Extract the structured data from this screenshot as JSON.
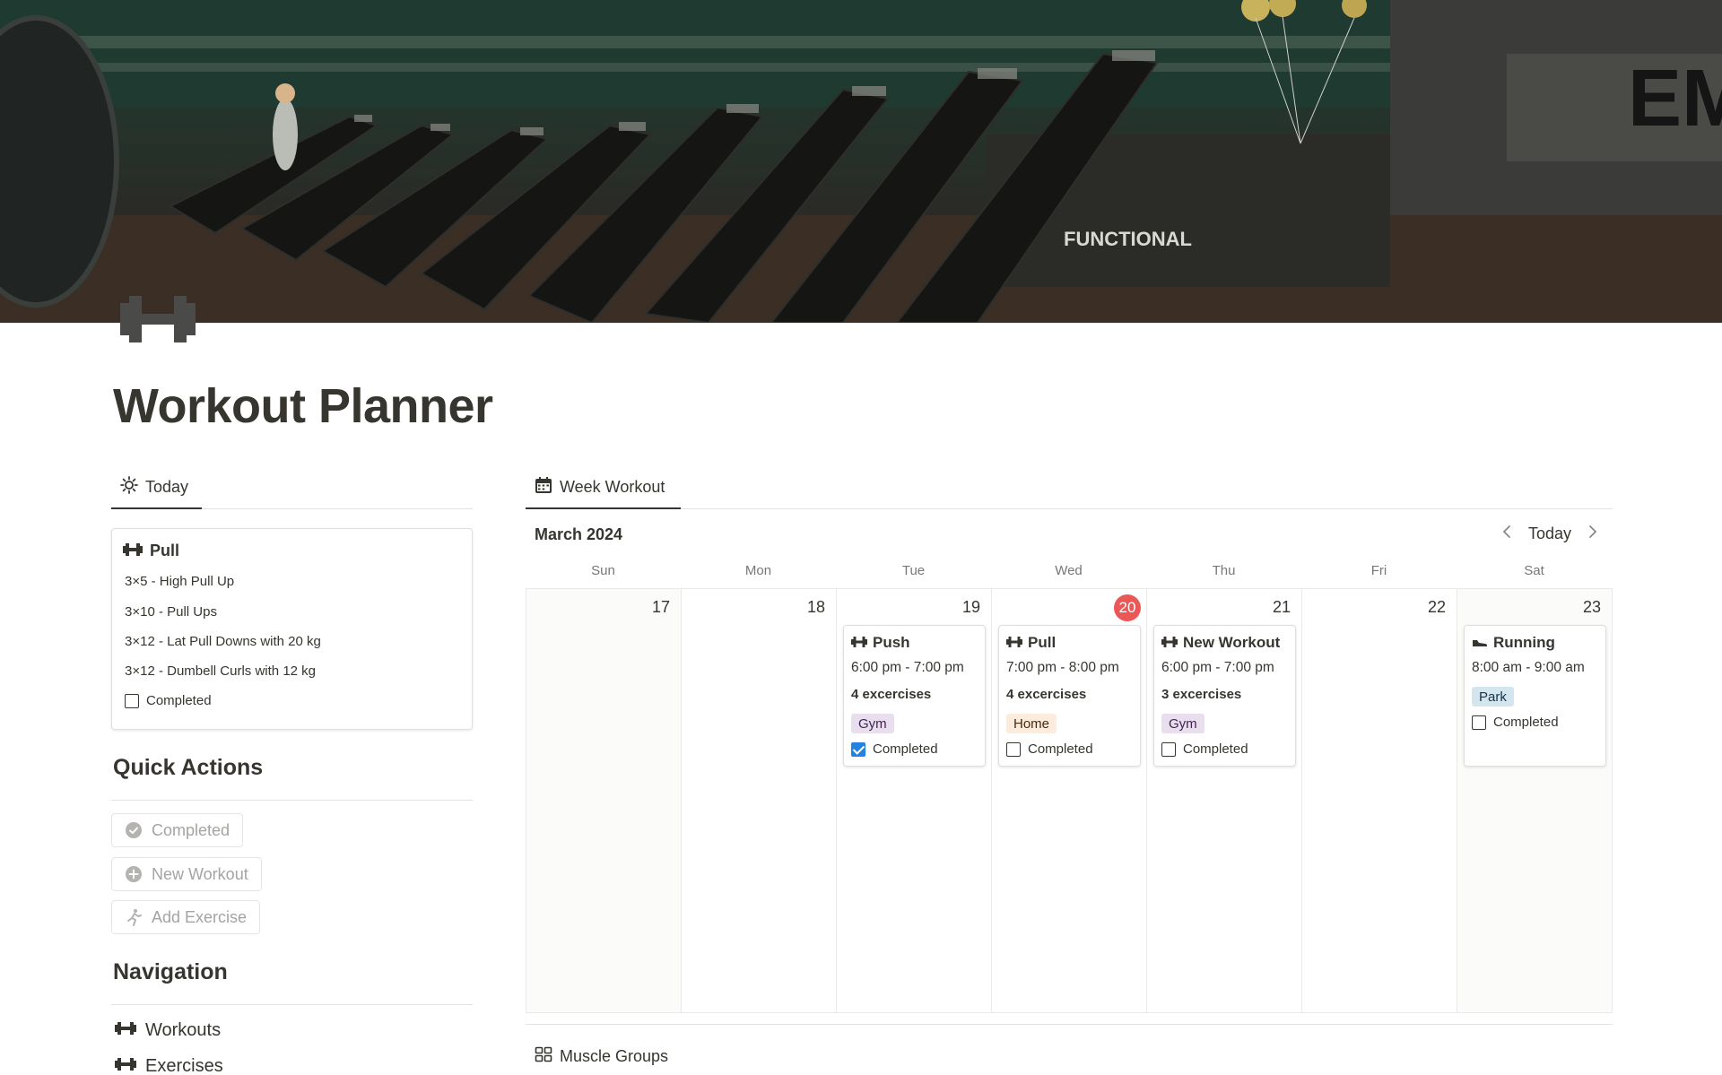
{
  "page": {
    "title": "Workout Planner"
  },
  "today_tab": {
    "label": "Today"
  },
  "today_card": {
    "workout": "Pull",
    "exercises": [
      "3×5 - High Pull Up",
      "3×10 - Pull Ups",
      "3×12 - Lat Pull Downs with 20 kg",
      "3×12 - Dumbell Curls with 12 kg"
    ],
    "completed_label": "Completed",
    "completed": false
  },
  "quick_actions": {
    "heading": "Quick Actions",
    "buttons": [
      {
        "label": "Completed",
        "icon": "check-circle-icon"
      },
      {
        "label": "New Workout",
        "icon": "plus-circle-icon"
      },
      {
        "label": "Add Exercise",
        "icon": "running-icon"
      }
    ]
  },
  "navigation": {
    "heading": "Navigation",
    "items": [
      {
        "label": "Workouts",
        "icon": "dumbbell-icon"
      },
      {
        "label": "Exercises",
        "icon": "dumbbell-icon"
      }
    ]
  },
  "week_tab": {
    "label": "Week Workout"
  },
  "calendar": {
    "month": "March 2024",
    "today_button": "Today",
    "weekdays": [
      "Sun",
      "Mon",
      "Tue",
      "Wed",
      "Thu",
      "Fri",
      "Sat"
    ],
    "days": [
      {
        "num": "17",
        "weekend": true,
        "is_today": false
      },
      {
        "num": "18",
        "weekend": false,
        "is_today": false
      },
      {
        "num": "19",
        "weekend": false,
        "is_today": false
      },
      {
        "num": "20",
        "weekend": false,
        "is_today": true
      },
      {
        "num": "21",
        "weekend": false,
        "is_today": false
      },
      {
        "num": "22",
        "weekend": false,
        "is_today": false
      },
      {
        "num": "23",
        "weekend": true,
        "is_today": false
      }
    ],
    "events": [
      {
        "day_index": 2,
        "icon": "dumbbell-icon",
        "title": "Push",
        "time": "6:00 pm - 7:00 pm",
        "count": "4 excercises",
        "tag": "Gym",
        "tag_style": "gym",
        "completed_label": "Completed",
        "completed": true
      },
      {
        "day_index": 3,
        "icon": "dumbbell-icon",
        "title": "Pull",
        "time": "7:00 pm - 8:00 pm",
        "count": "4 excercises",
        "tag": "Home",
        "tag_style": "home",
        "completed_label": "Completed",
        "completed": false
      },
      {
        "day_index": 4,
        "icon": "dumbbell-icon",
        "title": "New Workout",
        "time": "6:00 pm - 7:00 pm",
        "count": "3 excercises",
        "tag": "Gym",
        "tag_style": "gym",
        "completed_label": "Completed",
        "completed": false
      },
      {
        "day_index": 6,
        "icon": "shoe-icon",
        "title": "Running",
        "time": "8:00 am - 9:00 am",
        "count": "",
        "tag": "Park",
        "tag_style": "park",
        "completed_label": "Completed",
        "completed": false
      }
    ],
    "today_color": "#eb5757",
    "check_color": "#2383e2"
  },
  "muscle_groups": {
    "label": "Muscle Groups"
  }
}
